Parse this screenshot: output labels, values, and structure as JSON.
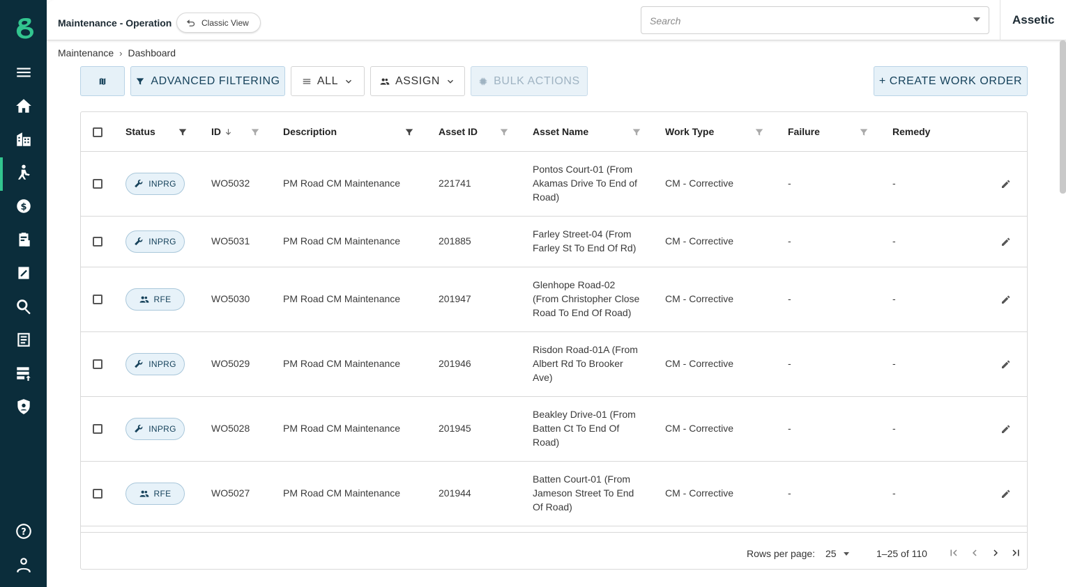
{
  "header": {
    "app_title": "Maintenance - Operation",
    "classic_view_label": "Classic View",
    "search_placeholder": "Search",
    "brand": "Assetic"
  },
  "sidebar": {
    "items": [
      {
        "icon": "menu-icon"
      },
      {
        "icon": "home-icon"
      },
      {
        "icon": "buildings-icon"
      },
      {
        "icon": "worker-icon",
        "active": true
      },
      {
        "icon": "finance-icon"
      },
      {
        "icon": "clipboard-icon"
      },
      {
        "icon": "edit-doc-icon"
      },
      {
        "icon": "search-icon"
      },
      {
        "icon": "document-list-icon"
      },
      {
        "icon": "data-import-icon"
      },
      {
        "icon": "security-icon"
      },
      {
        "icon": "help-icon"
      },
      {
        "icon": "user-icon"
      }
    ],
    "accent_color": "#32c58f",
    "bg_color": "#0b2d3b"
  },
  "breadcrumb": {
    "parent": "Maintenance",
    "separator": "›",
    "current": "Dashboard"
  },
  "toolbar": {
    "advanced_filtering": "ADVANCED FILTERING",
    "all": "ALL",
    "assign": "ASSIGN",
    "bulk_actions": "BULK ACTIONS",
    "create_work_order": "+ CREATE WORK ORDER"
  },
  "table": {
    "columns": {
      "status": "Status",
      "id": "ID",
      "description": "Description",
      "asset_id": "Asset ID",
      "asset_name": "Asset Name",
      "work_type": "Work Type",
      "failure": "Failure",
      "remedy": "Remedy"
    },
    "rows": [
      {
        "status": "INPRG",
        "status_icon": "wrench-icon",
        "id": "WO5032",
        "description": "PM Road CM Maintenance",
        "asset_id": "221741",
        "asset_name": [
          "Pontos Court-01 (From",
          "Akamas Drive To End of",
          "Road)"
        ],
        "work_type": "CM - Corrective",
        "failure": "-",
        "remedy": "-"
      },
      {
        "status": "INPRG",
        "status_icon": "wrench-icon",
        "id": "WO5031",
        "description": "PM Road CM Maintenance",
        "asset_id": "201885",
        "asset_name": [
          "Farley Street-04 (From",
          "Farley St To End Of Rd)"
        ],
        "work_type": "CM - Corrective",
        "failure": "-",
        "remedy": "-"
      },
      {
        "status": "RFE",
        "status_icon": "people-icon",
        "id": "WO5030",
        "description": "PM Road CM Maintenance",
        "asset_id": "201947",
        "asset_name": [
          "Glenhope Road-02",
          "(From Christopher Close",
          "Road To End Of Road)"
        ],
        "work_type": "CM - Corrective",
        "failure": "-",
        "remedy": "-"
      },
      {
        "status": "INPRG",
        "status_icon": "wrench-icon",
        "id": "WO5029",
        "description": "PM Road CM Maintenance",
        "asset_id": "201946",
        "asset_name": [
          "Risdon Road-01A (From",
          "Albert Rd To Brooker",
          "Ave)"
        ],
        "work_type": "CM - Corrective",
        "failure": "-",
        "remedy": "-"
      },
      {
        "status": "INPRG",
        "status_icon": "wrench-icon",
        "id": "WO5028",
        "description": "PM Road CM Maintenance",
        "asset_id": "201945",
        "asset_name": [
          "Beakley Drive-01 (From",
          "Batten Ct To End Of",
          "Road)"
        ],
        "work_type": "CM - Corrective",
        "failure": "-",
        "remedy": "-"
      },
      {
        "status": "RFE",
        "status_icon": "people-icon",
        "id": "WO5027",
        "description": "PM Road CM Maintenance",
        "asset_id": "201944",
        "asset_name": [
          "Batten Court-01 (From",
          "Jameson Street To End",
          "Of Road)"
        ],
        "work_type": "CM - Corrective",
        "failure": "-",
        "remedy": "-"
      }
    ]
  },
  "pagination": {
    "rows_per_page_label": "Rows per page:",
    "rows_per_page_value": "25",
    "range": "1–25 of 110"
  }
}
